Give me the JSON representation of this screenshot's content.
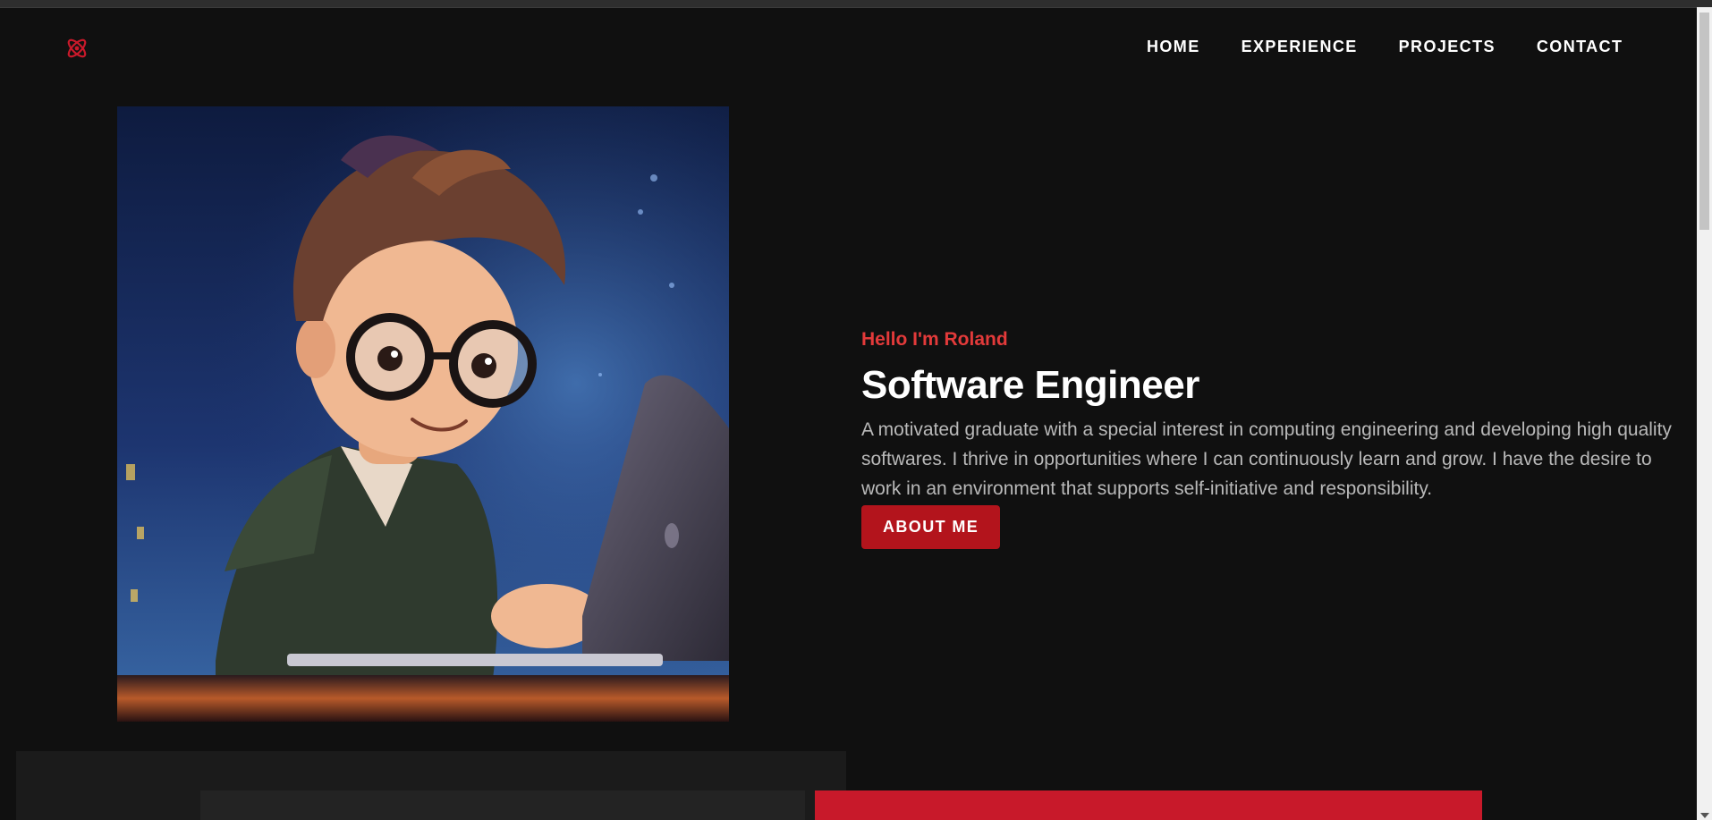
{
  "header": {
    "logo_icon": "atom-icon",
    "nav": [
      {
        "label": "HOME"
      },
      {
        "label": "EXPERIENCE"
      },
      {
        "label": "PROJECTS"
      },
      {
        "label": "CONTACT"
      }
    ]
  },
  "hero": {
    "image_icon": "avatar-illustration",
    "greeting": "Hello I'm Roland",
    "title": "Software Engineer",
    "description": "A motivated graduate with a special interest in computing engineering and developing high quality softwares. I thrive in opportunities where I can continuously learn and grow. I have the desire to work in an environment that supports self-initiative and responsibility.",
    "cta_label": "ABOUT ME"
  },
  "colors": {
    "background": "#101010",
    "accent": "#b3141c",
    "greeting": "#e33a3a",
    "text": "#ffffff",
    "muted_text": "#b9b9b9"
  }
}
